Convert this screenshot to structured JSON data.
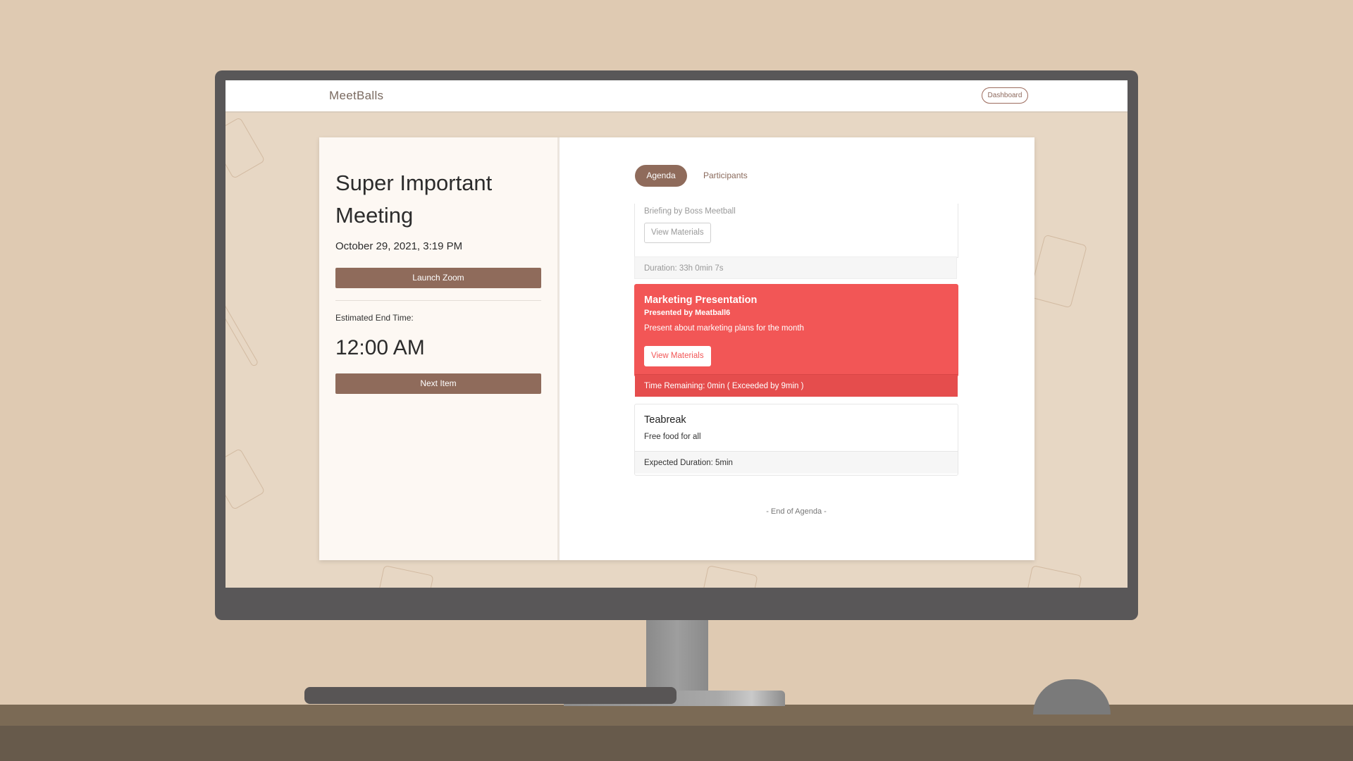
{
  "app": {
    "logo": "MeetBalls",
    "dashboard_label": "Dashboard"
  },
  "meeting": {
    "title": "Super Important Meeting",
    "datetime": "October 29, 2021, 3:19 PM",
    "launch_label": "Launch Zoom",
    "end_time_label": "Estimated End Time:",
    "end_time": "12:00 AM",
    "next_label": "Next Item"
  },
  "tabs": [
    {
      "label": "Agenda",
      "active": true
    },
    {
      "label": "Participants",
      "active": false
    }
  ],
  "agenda": {
    "items": [
      {
        "title": "",
        "presenter": "",
        "description": "Briefing by Boss Meetball",
        "materials_label": "View Materials",
        "footer": "Duration: 33h 0min 7s",
        "state": "done"
      },
      {
        "title": "Marketing Presentation",
        "presenter": "Presented by Meatball6",
        "description": "Present about marketing plans for the month",
        "materials_label": "View Materials",
        "footer": "Time Remaining: 0min ( Exceeded by 9min )",
        "state": "active"
      },
      {
        "title": "Teabreak",
        "presenter": "",
        "description": "Free food for all",
        "footer": "Expected Duration: 5min",
        "state": "upcoming"
      }
    ],
    "end_text": "- End of Agenda -"
  },
  "colors": {
    "brand": "#8f6b5b",
    "active_item": "#f25656",
    "background": "#dfcab2"
  }
}
